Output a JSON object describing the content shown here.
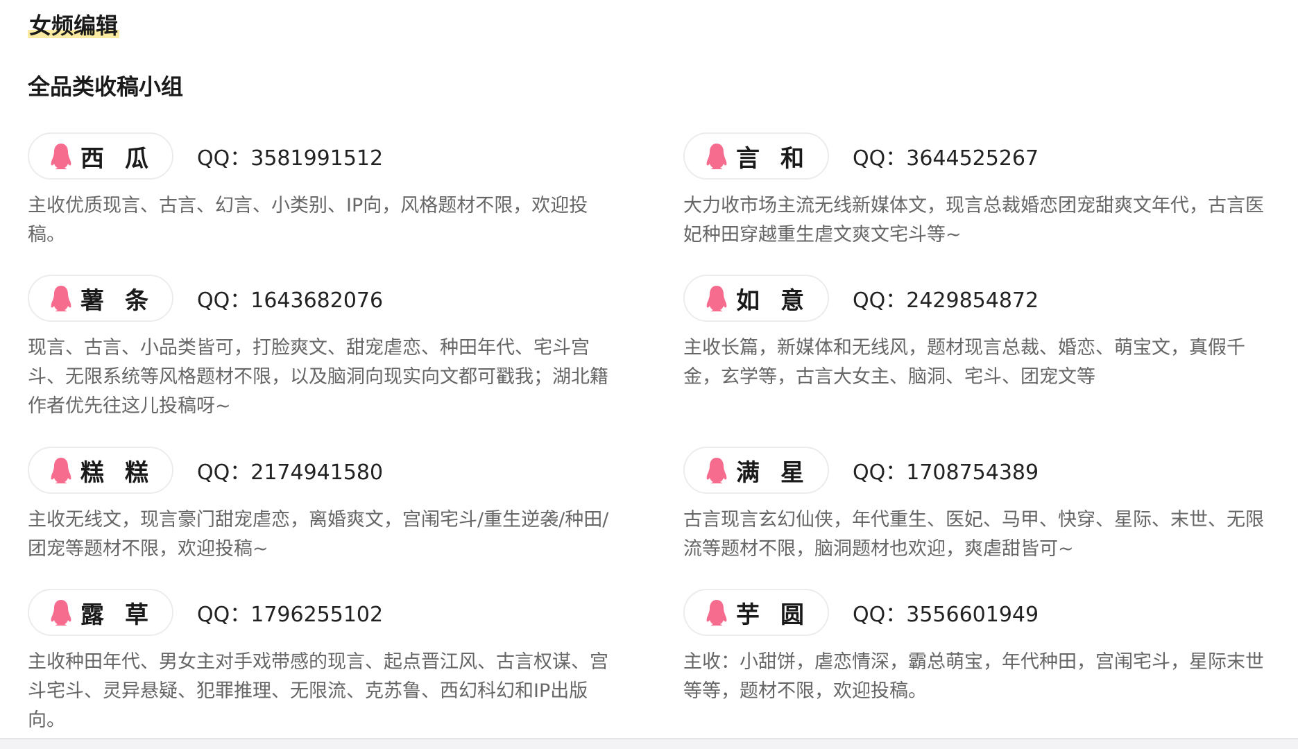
{
  "section": {
    "title": "女频编辑"
  },
  "group": {
    "title": "全品类收稿小组"
  },
  "qq_prefix": "QQ：",
  "colors": {
    "icon": "#f56c8f",
    "highlight": "#fbeaa1",
    "desc_text": "#666666"
  },
  "editors": [
    {
      "name": "西瓜",
      "qq": "3581991512",
      "description": "主收优质现言、古言、幻言、小类别、IP向，风格题材不限，欢迎投稿。"
    },
    {
      "name": "言和",
      "qq": "3644525267",
      "description": "大力收市场主流无线新媒体文，现言总裁婚恋团宠甜爽文年代，古言医妃种田穿越重生虐文爽文宅斗等~"
    },
    {
      "name": "薯条",
      "qq": "1643682076",
      "description": "现言、古言、小品类皆可，打脸爽文、甜宠虐恋、种田年代、宅斗宫斗、无限系统等风格题材不限，以及脑洞向现实向文都可戳我；湖北籍作者优先往这儿投稿呀~"
    },
    {
      "name": "如意",
      "qq": "2429854872",
      "description": "主收长篇，新媒体和无线风，题材现言总裁、婚恋、萌宝文，真假千金，玄学等，古言大女主、脑洞、宅斗、团宠文等"
    },
    {
      "name": "糕糕",
      "qq": "2174941580",
      "description": "主收无线文，现言豪门甜宠虐恋，离婚爽文，宫闱宅斗/重生逆袭/种田/团宠等题材不限，欢迎投稿~"
    },
    {
      "name": "满星",
      "qq": "1708754389",
      "description": "古言现言玄幻仙侠，年代重生、医妃、马甲、快穿、星际、末世、无限流等题材不限，脑洞题材也欢迎，爽虐甜皆可~"
    },
    {
      "name": "露草",
      "qq": "1796255102",
      "description": "主收种田年代、男女主对手戏带感的现言、起点晋江风、古言权谋、宫斗宅斗、灵异悬疑、犯罪推理、无限流、克苏鲁、西幻科幻和IP出版向。"
    },
    {
      "name": "芋圆",
      "qq": "3556601949",
      "description": "主收：小甜饼，虐恋情深，霸总萌宝，年代种田，宫闱宅斗，星际末世等等，题材不限，欢迎投稿。"
    }
  ]
}
